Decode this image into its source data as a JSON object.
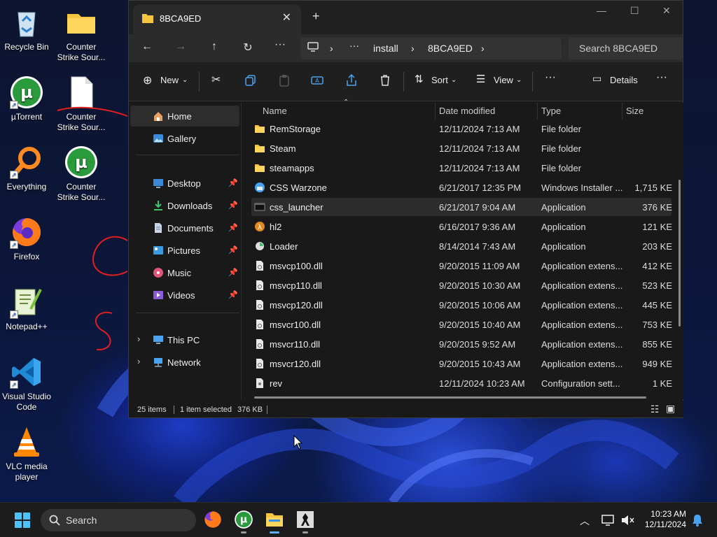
{
  "desktop": {
    "icons": [
      {
        "label": "Recycle Bin",
        "icon": "recycle-bin-icon"
      },
      {
        "label": "Counter Strike Sour...",
        "icon": "folder-icon"
      },
      {
        "label": "µTorrent",
        "icon": "utorrent-icon"
      },
      {
        "label": "Counter Strike Sour...",
        "icon": "document-icon"
      },
      {
        "label": "Everything",
        "icon": "everything-search-icon"
      },
      {
        "label": "Counter Strike Sour...",
        "icon": "utorrent-icon"
      },
      {
        "label": "Firefox",
        "icon": "firefox-icon"
      },
      {
        "label": "Notepad++",
        "icon": "notepadpp-icon"
      },
      {
        "label": "Visual Studio Code",
        "icon": "vscode-icon"
      },
      {
        "label": "VLC media player",
        "icon": "vlc-icon"
      }
    ]
  },
  "explorer": {
    "tab_title": "8BCA9ED",
    "new_tab": "+",
    "close_tab": "✕",
    "window_controls": {
      "minimize": "—",
      "maximize": "☐",
      "close": "✕"
    },
    "breadcrumb": {
      "ellipsis": "···",
      "items": [
        "install",
        "8BCA9ED"
      ]
    },
    "search_placeholder": "Search 8BCA9ED",
    "toolbar": {
      "new_label": "New",
      "sort_label": "Sort",
      "view_label": "View",
      "more": "···",
      "details_label": "Details"
    },
    "sidebar": {
      "home": "Home",
      "gallery": "Gallery",
      "pinned": [
        {
          "label": "Desktop",
          "icon": "desktop-icon"
        },
        {
          "label": "Downloads",
          "icon": "download-icon"
        },
        {
          "label": "Documents",
          "icon": "documents-icon"
        },
        {
          "label": "Pictures",
          "icon": "pictures-icon"
        },
        {
          "label": "Music",
          "icon": "music-icon"
        },
        {
          "label": "Videos",
          "icon": "videos-icon"
        }
      ],
      "this_pc": "This PC",
      "network": "Network"
    },
    "columns": {
      "name": "Name",
      "date": "Date modified",
      "type": "Type",
      "size": "Size"
    },
    "files": [
      {
        "name": "RemStorage",
        "date": "12/11/2024 7:13 AM",
        "type": "File folder",
        "size": "",
        "icon": "folder-icon"
      },
      {
        "name": "Steam",
        "date": "12/11/2024 7:13 AM",
        "type": "File folder",
        "size": "",
        "icon": "folder-icon"
      },
      {
        "name": "steamapps",
        "date": "12/11/2024 7:13 AM",
        "type": "File folder",
        "size": "",
        "icon": "folder-icon"
      },
      {
        "name": "CSS Warzone",
        "date": "6/21/2017 12:35 PM",
        "type": "Windows Installer ...",
        "size": "1,715 KE",
        "icon": "installer-icon"
      },
      {
        "name": "css_launcher",
        "date": "6/21/2017 9:04 AM",
        "type": "Application",
        "size": "376 KE",
        "icon": "app-icon"
      },
      {
        "name": "hl2",
        "date": "6/16/2017 9:36 AM",
        "type": "Application",
        "size": "121 KE",
        "icon": "hl2-icon"
      },
      {
        "name": "Loader",
        "date": "8/14/2014 7:43 AM",
        "type": "Application",
        "size": "203 KE",
        "icon": "loader-icon"
      },
      {
        "name": "msvcp100.dll",
        "date": "9/20/2015 11:09 AM",
        "type": "Application extens...",
        "size": "412 KE",
        "icon": "dll-icon"
      },
      {
        "name": "msvcp110.dll",
        "date": "9/20/2015 10:30 AM",
        "type": "Application extens...",
        "size": "523 KE",
        "icon": "dll-icon"
      },
      {
        "name": "msvcp120.dll",
        "date": "9/20/2015 10:06 AM",
        "type": "Application extens...",
        "size": "445 KE",
        "icon": "dll-icon"
      },
      {
        "name": "msvcr100.dll",
        "date": "9/20/2015 10:40 AM",
        "type": "Application extens...",
        "size": "753 KE",
        "icon": "dll-icon"
      },
      {
        "name": "msvcr110.dll",
        "date": "9/20/2015 9:52 AM",
        "type": "Application extens...",
        "size": "855 KE",
        "icon": "dll-icon"
      },
      {
        "name": "msvcr120.dll",
        "date": "9/20/2015 10:43 AM",
        "type": "Application extens...",
        "size": "949 KE",
        "icon": "dll-icon"
      },
      {
        "name": "rev",
        "date": "12/11/2024 10:23 AM",
        "type": "Configuration sett...",
        "size": "1 KE",
        "icon": "config-icon"
      }
    ],
    "selected_index": 4,
    "status": {
      "items": "25 items",
      "selected": "1 item selected",
      "size": "376 KB"
    }
  },
  "taskbar": {
    "search_label": "Search",
    "time": "10:23 AM",
    "date": "12/11/2024",
    "apps": [
      "firefox-icon",
      "utorrent-icon",
      "file-explorer-icon",
      "counter-strike-icon"
    ]
  },
  "colors": {
    "accent": "#0078d4",
    "folder": "#e8b84a",
    "utorrent": "#2a9b3c",
    "window_bg": "#191919"
  }
}
